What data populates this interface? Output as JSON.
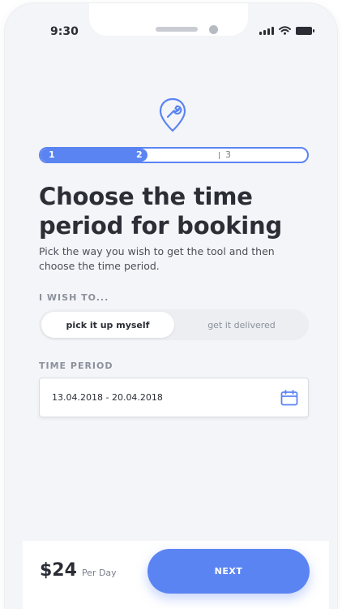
{
  "status_bar": {
    "time": "9:30"
  },
  "progress": {
    "steps": [
      "1",
      "2",
      "3"
    ],
    "current_step": 2,
    "fill_fraction": 0.4
  },
  "heading": {
    "title_line1": "Choose the time",
    "title_line2": "period for booking",
    "subtitle": "Pick the way you wish to get the tool and then choose the time period."
  },
  "wish": {
    "label": "I WISH TO...",
    "options": [
      "pick it up myself",
      "get it delivered"
    ],
    "selected": "pick it up myself"
  },
  "period": {
    "label": "TIME PERIOD",
    "value": "13.04.2018 - 20.04.2018"
  },
  "footer": {
    "price": "$24",
    "price_unit": "Per Day",
    "next_label": "NEXT"
  },
  "colors": {
    "accent": "#5b84f3",
    "background": "#f4f5f8",
    "text": "#2a2d34",
    "muted": "#8b909b"
  },
  "icons": [
    "wrench-location-icon",
    "signal-icon",
    "wifi-icon",
    "battery-icon",
    "calendar-icon"
  ]
}
